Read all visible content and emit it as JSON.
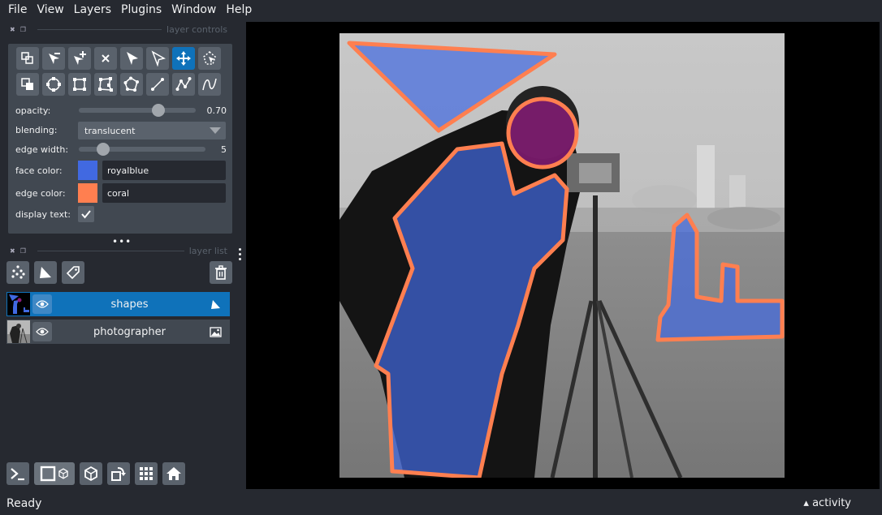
{
  "menu": [
    "File",
    "View",
    "Layers",
    "Plugins",
    "Window",
    "Help"
  ],
  "layer_controls": {
    "title": "layer controls",
    "opacity": {
      "label": "opacity:",
      "value": "0.70",
      "fraction": 0.7
    },
    "blending": {
      "label": "blending:",
      "value": "translucent"
    },
    "edge_width": {
      "label": "edge width:",
      "value": "5",
      "fraction": 0.16
    },
    "face_color": {
      "label": "face color:",
      "value": "royalblue",
      "swatch": "#4169e1"
    },
    "edge_color": {
      "label": "edge color:",
      "value": "coral",
      "swatch": "#ff7f50"
    },
    "display_text": {
      "label": "display text:",
      "checked": true
    }
  },
  "layer_list": {
    "title": "layer list",
    "layers": [
      {
        "name": "shapes",
        "type": "shapes",
        "visible": true,
        "selected": true
      },
      {
        "name": "photographer",
        "type": "image",
        "visible": true,
        "selected": false
      }
    ]
  },
  "status": {
    "text": "Ready",
    "activity": "activity"
  },
  "colors": {
    "accent": "#0f72ba",
    "panel": "#414851",
    "bg": "#262930",
    "button": "#5a626c"
  }
}
